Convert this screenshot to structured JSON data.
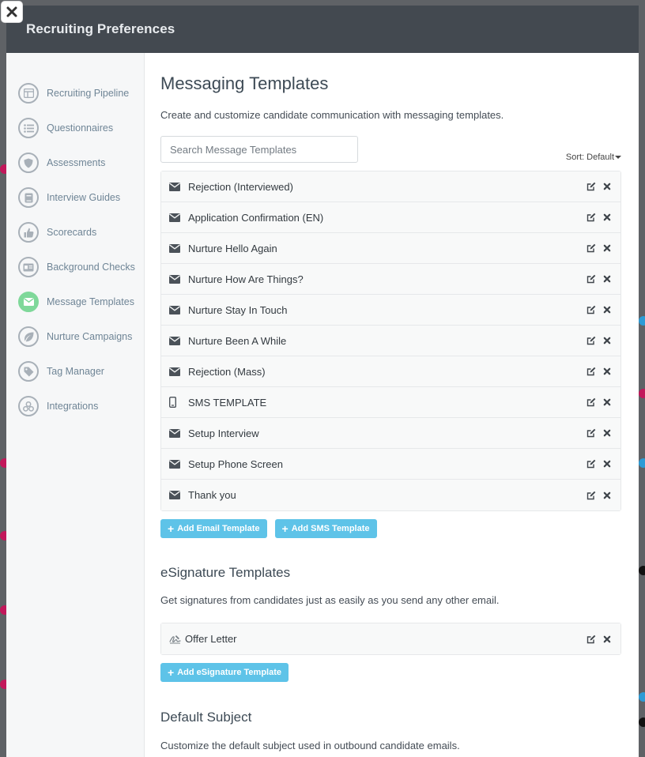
{
  "window": {
    "title": "Recruiting Preferences"
  },
  "sidebar": {
    "items": [
      {
        "label": "Recruiting Pipeline",
        "icon": "pipeline-icon"
      },
      {
        "label": "Questionnaires",
        "icon": "list-icon"
      },
      {
        "label": "Assessments",
        "icon": "shield-icon"
      },
      {
        "label": "Interview Guides",
        "icon": "book-icon"
      },
      {
        "label": "Scorecards",
        "icon": "thumbs-up-icon"
      },
      {
        "label": "Background Checks",
        "icon": "id-card-icon"
      },
      {
        "label": "Message Templates",
        "icon": "envelope-icon",
        "active": true
      },
      {
        "label": "Nurture Campaigns",
        "icon": "leaf-icon"
      },
      {
        "label": "Tag Manager",
        "icon": "tag-icon"
      },
      {
        "label": "Integrations",
        "icon": "cubes-icon"
      }
    ]
  },
  "messaging": {
    "title": "Messaging Templates",
    "description": "Create and customize candidate communication with messaging templates.",
    "search_placeholder": "Search Message Templates",
    "sort_label": "Sort: Default",
    "templates": [
      {
        "name": "Rejection (Interviewed)",
        "type": "email"
      },
      {
        "name": "Application Confirmation (EN)",
        "type": "email"
      },
      {
        "name": "Nurture Hello Again",
        "type": "email"
      },
      {
        "name": "Nurture How Are Things?",
        "type": "email"
      },
      {
        "name": "Nurture Stay In Touch",
        "type": "email"
      },
      {
        "name": "Nurture Been A While",
        "type": "email"
      },
      {
        "name": "Rejection (Mass)",
        "type": "email"
      },
      {
        "name": "SMS TEMPLATE",
        "type": "sms"
      },
      {
        "name": "Setup Interview",
        "type": "email"
      },
      {
        "name": "Setup Phone Screen",
        "type": "email"
      },
      {
        "name": "Thank you",
        "type": "email"
      }
    ],
    "add_email_label": "Add Email Template",
    "add_sms_label": "Add SMS Template"
  },
  "esignature": {
    "title": "eSignature Templates",
    "description": "Get signatures from candidates just as easily as you send any other email.",
    "templates": [
      {
        "name": "Offer Letter"
      }
    ],
    "add_label": "Add eSignature Template"
  },
  "default_subject": {
    "title": "Default Subject",
    "description": "Customize the default subject used in outbound candidate emails."
  },
  "colors": {
    "header": "#434950",
    "accent_button": "#5ec3e8",
    "active_nav": "#7fd89a",
    "sidebar_bg": "#f6f7f8"
  }
}
